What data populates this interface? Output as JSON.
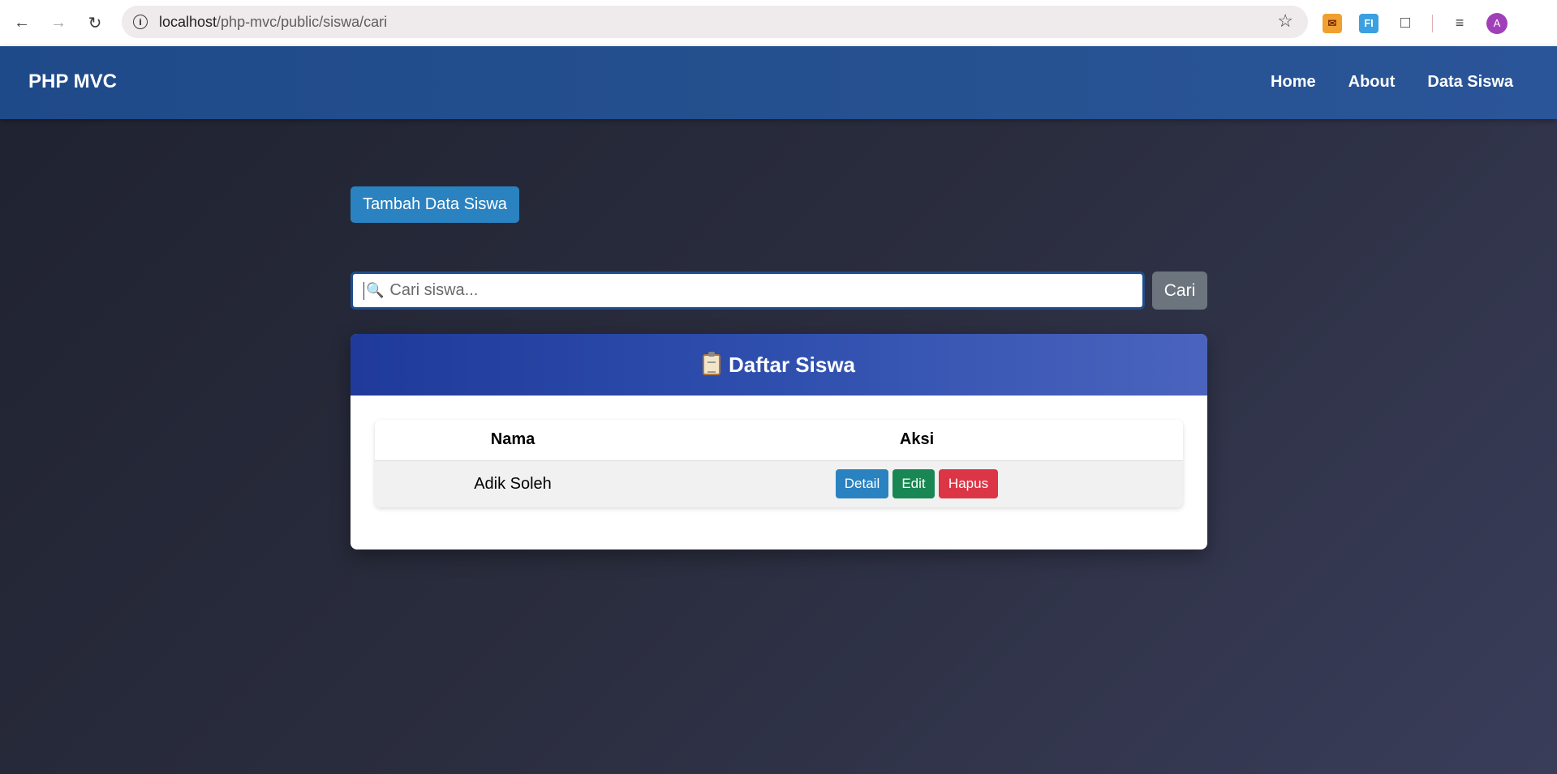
{
  "browser": {
    "url_host": "localhost",
    "url_path": "/php-mvc/public/siswa/cari",
    "avatar_letter": "A",
    "ext_b_label": "FI"
  },
  "navbar": {
    "brand": "PHP MVC",
    "links": [
      "Home",
      "About",
      "Data Siswa"
    ]
  },
  "main": {
    "add_button": "Tambah Data Siswa",
    "search": {
      "placeholder": "Cari siswa...",
      "value": "",
      "button": "Cari"
    },
    "card_title": "Daftar Siswa",
    "table": {
      "headers": [
        "Nama",
        "Aksi"
      ],
      "rows": [
        {
          "nama": "Adik Soleh",
          "actions": [
            "Detail",
            "Edit",
            "Hapus"
          ]
        }
      ]
    }
  },
  "colors": {
    "navbar": "#25508f",
    "primary": "#2a82c0",
    "success": "#198754",
    "danger": "#dc3545",
    "secondary": "#6c757d"
  },
  "icons": [
    "back-icon",
    "forward-icon",
    "reload-icon",
    "info-icon",
    "star-icon",
    "puzzle-icon",
    "media-icon",
    "search-icon",
    "clipboard-icon"
  ]
}
